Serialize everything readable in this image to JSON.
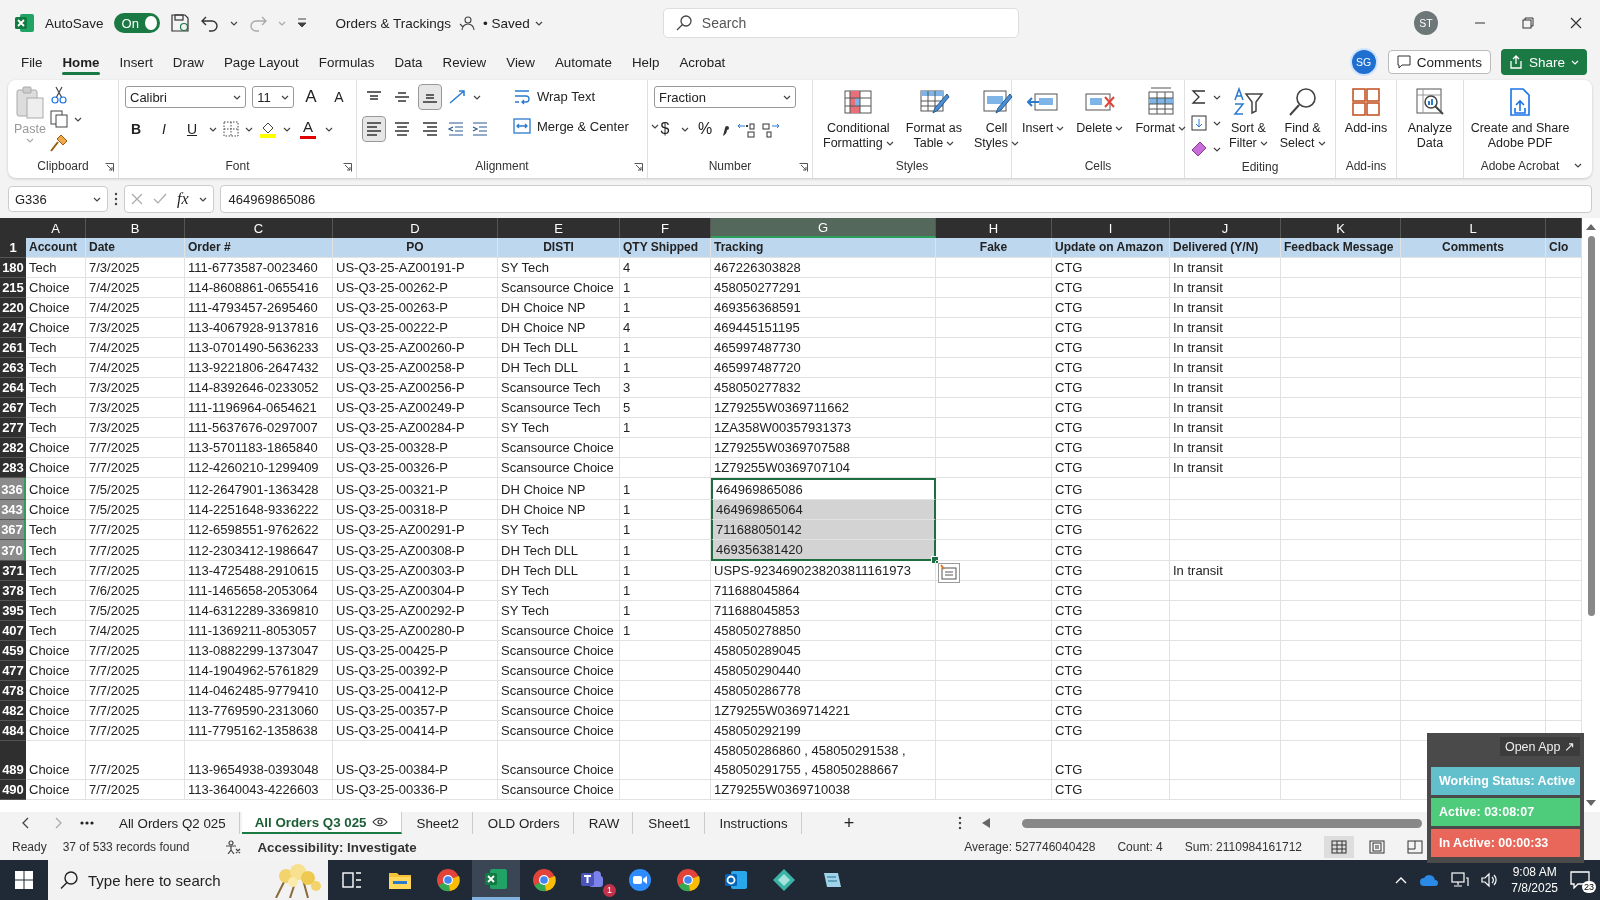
{
  "app": {
    "autosave_label": "AutoSave",
    "autosave_on": true,
    "autosave_state": "On",
    "title": "Orders & Trackings",
    "save_status": "• Saved",
    "search_placeholder": "Search",
    "user_initials": "ST"
  },
  "menu_tabs": [
    {
      "label": "File",
      "selected": false
    },
    {
      "label": "Home",
      "selected": true
    },
    {
      "label": "Insert",
      "selected": false
    },
    {
      "label": "Draw",
      "selected": false
    },
    {
      "label": "Page Layout",
      "selected": false
    },
    {
      "label": "Formulas",
      "selected": false
    },
    {
      "label": "Data",
      "selected": false
    },
    {
      "label": "Review",
      "selected": false
    },
    {
      "label": "View",
      "selected": false
    },
    {
      "label": "Automate",
      "selected": false
    },
    {
      "label": "Help",
      "selected": false
    },
    {
      "label": "Acrobat",
      "selected": false
    }
  ],
  "account": {
    "avatar": "SG",
    "comments": "Comments",
    "share": "Share"
  },
  "ribbon": {
    "clipboard": {
      "label": "Clipboard",
      "paste": "Paste",
      "paste_disabled": true
    },
    "font": {
      "label": "Font",
      "family": "Calibri",
      "size": "11",
      "size_buttons": [
        "A",
        "A"
      ],
      "style_buttons": [
        "B",
        "I",
        "U"
      ],
      "color_button": "A"
    },
    "alignment": {
      "label": "Alignment",
      "wrap": "Wrap Text",
      "merge": "Merge & Center",
      "vertical": [
        {
          "selected": false
        },
        {
          "selected": false
        },
        {
          "selected": true
        }
      ],
      "horizontal": [
        {
          "selected": true
        },
        {
          "selected": false
        },
        {
          "selected": false
        }
      ]
    },
    "number": {
      "label": "Number",
      "format": "Fraction",
      "symbols": [
        "$",
        "%"
      ]
    },
    "styles": {
      "label": "Styles",
      "buttons": [
        {
          "lines": [
            "Conditional",
            "Formatting"
          ],
          "dropdown": true
        },
        {
          "lines": [
            "Format as",
            "Table"
          ],
          "dropdown": true
        },
        {
          "lines": [
            "Cell",
            "Styles"
          ],
          "dropdown": true
        }
      ]
    },
    "cells": {
      "label": "Cells",
      "buttons": [
        {
          "lines": [
            "Insert"
          ],
          "dropdown": true
        },
        {
          "lines": [
            "Delete"
          ],
          "dropdown": true
        },
        {
          "lines": [
            "Format"
          ],
          "dropdown": true
        }
      ]
    },
    "editing": {
      "label": "Editing",
      "buttons": [
        {
          "lines": [
            "Sort &",
            "Filter"
          ],
          "dropdown": true
        },
        {
          "lines": [
            "Find &",
            "Select"
          ],
          "dropdown": true
        }
      ]
    },
    "addins": {
      "label": "Add-ins",
      "buttons": [
        {
          "lines": [
            "Add-ins"
          ],
          "dropdown": false
        }
      ]
    },
    "analysis": {
      "buttons": [
        {
          "lines": [
            "Analyze",
            "Data"
          ],
          "dropdown": false
        }
      ]
    },
    "acrobat": {
      "label": "Adobe Acrobat",
      "buttons": [
        {
          "lines": [
            "Create and Share",
            "Adobe PDF"
          ],
          "dropdown": false
        }
      ]
    }
  },
  "formula_bar": {
    "name_box": "G336",
    "function_label": "fx",
    "value": "464969865086"
  },
  "columns": [
    {
      "letter": "A",
      "header": "Account",
      "selected": false
    },
    {
      "letter": "B",
      "header": "Date",
      "selected": false
    },
    {
      "letter": "C",
      "header": "Order #",
      "selected": false
    },
    {
      "letter": "D",
      "header": "PO",
      "selected": false
    },
    {
      "letter": "E",
      "header": "DISTI",
      "selected": false
    },
    {
      "letter": "F",
      "header": "QTY Shipped",
      "selected": false
    },
    {
      "letter": "G",
      "header": "Tracking",
      "selected": true
    },
    {
      "letter": "H",
      "header": "Fake",
      "selected": false
    },
    {
      "letter": "I",
      "header": "Update on Amazon",
      "selected": false
    },
    {
      "letter": "J",
      "header": "Delivered (Y/N)",
      "selected": false
    },
    {
      "letter": "K",
      "header": "Feedback Message",
      "selected": false
    },
    {
      "letter": "L",
      "header": "Comments",
      "selected": false
    },
    {
      "header": "Clo",
      "selected": false
    }
  ],
  "header_row": "1",
  "rows": [
    {
      "n": "180",
      "selected": false,
      "account": "Tech",
      "date": "7/3/2025",
      "order": "111-6773587-0023460",
      "po": "US-Q3-25-AZ00191-P",
      "disti": "SY Tech",
      "qty": "4",
      "tracking": "467226303828",
      "update": "CTG",
      "delivered": "In transit"
    },
    {
      "n": "215",
      "selected": false,
      "account": "Choice",
      "date": "7/4/2025",
      "order": "114-8608861-0655416",
      "po": "US-Q3-25-00262-P",
      "disti": "Scansource Choice",
      "qty": "1",
      "tracking": "458050277291",
      "update": "CTG",
      "delivered": "In transit"
    },
    {
      "n": "220",
      "selected": false,
      "account": "Choice",
      "date": "7/4/2025",
      "order": "111-4793457-2695460",
      "po": "US-Q3-25-00263-P",
      "disti": "DH Choice NP",
      "qty": "1",
      "tracking": "469356368591",
      "update": "CTG",
      "delivered": "In transit"
    },
    {
      "n": "247",
      "selected": false,
      "account": "Choice",
      "date": "7/3/2025",
      "order": "113-4067928-9137816",
      "po": "US-Q3-25-00222-P",
      "disti": "DH Choice NP",
      "qty": "4",
      "tracking": "469445151195",
      "update": "CTG",
      "delivered": "In transit"
    },
    {
      "n": "261",
      "selected": false,
      "account": "Tech",
      "date": "7/4/2025",
      "order": "113-0701490-5636233",
      "po": "US-Q3-25-AZ00260-P",
      "disti": "DH Tech DLL",
      "qty": "1",
      "tracking": "465997487730",
      "update": "CTG",
      "delivered": "In transit"
    },
    {
      "n": "263",
      "selected": false,
      "account": "Tech",
      "date": "7/4/2025",
      "order": "113-9221806-2647432",
      "po": "US-Q3-25-AZ00258-P",
      "disti": "DH Tech DLL",
      "qty": "1",
      "tracking": "465997487720",
      "update": "CTG",
      "delivered": "In transit"
    },
    {
      "n": "264",
      "selected": false,
      "account": "Tech",
      "date": "7/3/2025",
      "order": "114-8392646-0233052",
      "po": "US-Q3-25-AZ00256-P",
      "disti": "Scansource Tech",
      "qty": "3",
      "tracking": "458050277832",
      "update": "CTG",
      "delivered": "In transit"
    },
    {
      "n": "267",
      "selected": false,
      "account": "Tech",
      "date": "7/3/2025",
      "order": "111-1196964-0654621",
      "po": "US-Q3-25-AZ00249-P",
      "disti": "Scansource Tech",
      "qty": "5",
      "tracking": "1Z79255W0369711662",
      "update": "CTG",
      "delivered": "In transit"
    },
    {
      "n": "277",
      "selected": false,
      "account": "Tech",
      "date": "7/3/2025",
      "order": "111-5637676-0297007",
      "po": "US-Q3-25-AZ00284-P",
      "disti": "SY Tech",
      "qty": "1",
      "tracking": "1ZA358W00357931373",
      "update": "CTG",
      "delivered": "In transit"
    },
    {
      "n": "282",
      "selected": false,
      "account": "Choice",
      "date": "7/7/2025",
      "order": "113-5701183-1865840",
      "po": "US-Q3-25-00328-P",
      "disti": "Scansource Choice",
      "tracking": "1Z79255W0369707588",
      "update": "CTG",
      "delivered": "In transit"
    },
    {
      "n": "283",
      "selected": false,
      "account": "Choice",
      "date": "7/7/2025",
      "order": "112-4260210-1299409",
      "po": "US-Q3-25-00326-P",
      "disti": "Scansource Choice",
      "tracking": "1Z79255W0369707104",
      "update": "CTG",
      "delivered": "In transit"
    },
    {
      "n": "336",
      "selected": true,
      "account": "Choice",
      "date": "7/5/2025",
      "order": "112-2647901-1363428",
      "po": "US-Q3-25-00321-P",
      "disti": "DH Choice NP",
      "qty": "1",
      "tracking": "464969865086",
      "update": "CTG"
    },
    {
      "n": "343",
      "selected": true,
      "account": "Choice",
      "date": "7/5/2025",
      "order": "114-2251648-9336222",
      "po": "US-Q3-25-00318-P",
      "disti": "DH Choice NP",
      "qty": "1",
      "tracking": "464969865064",
      "update": "CTG"
    },
    {
      "n": "367",
      "selected": true,
      "account": "Tech",
      "date": "7/7/2025",
      "order": "112-6598551-9762622",
      "po": "US-Q3-25-AZ00291-P",
      "disti": "SY Tech",
      "qty": "1",
      "tracking": "711688050142",
      "update": "CTG"
    },
    {
      "n": "370",
      "selected": true,
      "account": "Tech",
      "date": "7/7/2025",
      "order": "112-2303412-1986647",
      "po": "US-Q3-25-AZ00308-P",
      "disti": "DH Tech DLL",
      "qty": "1",
      "tracking": "469356381420",
      "update": "CTG"
    },
    {
      "n": "371",
      "selected": false,
      "account": "Tech",
      "date": "7/7/2025",
      "order": "113-4725488-2910615",
      "po": "US-Q3-25-AZ00303-P",
      "disti": "DH Tech DLL",
      "qty": "1",
      "tracking": "USPS-9234690238203811161973",
      "update": "CTG",
      "delivered": "In transit"
    },
    {
      "n": "378",
      "selected": false,
      "account": "Tech",
      "date": "7/6/2025",
      "order": "111-1465658-2053064",
      "po": "US-Q3-25-AZ00304-P",
      "disti": "SY Tech",
      "qty": "1",
      "tracking": "711688045864",
      "update": "CTG"
    },
    {
      "n": "395",
      "selected": false,
      "account": "Tech",
      "date": "7/5/2025",
      "order": "114-6312289-3369810",
      "po": "US-Q3-25-AZ00292-P",
      "disti": "SY Tech",
      "qty": "1",
      "tracking": "711688045853",
      "update": "CTG"
    },
    {
      "n": "407",
      "selected": false,
      "account": "Tech",
      "date": "7/4/2025",
      "order": "111-1369211-8053057",
      "po": "US-Q3-25-AZ00280-P",
      "disti": "Scansource Choice",
      "qty": "1",
      "tracking": "458050278850",
      "update": "CTG"
    },
    {
      "n": "459",
      "selected": false,
      "account": "Choice",
      "date": "7/7/2025",
      "order": "113-0882299-1373047",
      "po": "US-Q3-25-00425-P",
      "disti": "Scansource Choice",
      "tracking": "458050289045",
      "update": "CTG"
    },
    {
      "n": "477",
      "selected": false,
      "account": "Choice",
      "date": "7/7/2025",
      "order": "114-1904962-5761829",
      "po": "US-Q3-25-00392-P",
      "disti": "Scansource Choice",
      "tracking": "458050290440",
      "update": "CTG"
    },
    {
      "n": "478",
      "selected": false,
      "account": "Choice",
      "date": "7/7/2025",
      "order": "114-0462485-9779410",
      "po": "US-Q3-25-00412-P",
      "disti": "Scansource Choice",
      "tracking": "458050286778",
      "update": "CTG"
    },
    {
      "n": "482",
      "selected": false,
      "account": "Choice",
      "date": "7/7/2025",
      "order": "113-7769590-2313060",
      "po": "US-Q3-25-00357-P",
      "disti": "Scansource Choice",
      "tracking": "1Z79255W0369714221",
      "update": "CTG"
    },
    {
      "n": "484",
      "selected": false,
      "account": "Choice",
      "date": "7/7/2025",
      "order": "111-7795162-1358638",
      "po": "US-Q3-25-00414-P",
      "disti": "Scansource Choice",
      "tracking": "458050292199",
      "update": "CTG"
    },
    {
      "n": "489",
      "selected": false,
      "account": "Choice",
      "date": "7/7/2025",
      "order": "113-9654938-0393048",
      "po": "US-Q3-25-00384-P",
      "disti": "Scansource Choice",
      "tracking": "458050286860 , 458050291538 , 458050291755 , 458050288667",
      "update": "CTG"
    },
    {
      "n": "490",
      "selected": false,
      "account": "Choice",
      "date": "7/7/2025",
      "order": "113-3640043-4226603",
      "po": "US-Q3-25-00336-P",
      "disti": "Scansource Choice",
      "tracking": "1Z79255W0369710038",
      "update": "CTG"
    }
  ],
  "sheet_tabs": [
    {
      "label": "All Orders Q2 025",
      "selected": false
    },
    {
      "label": "All Orders Q3 025",
      "selected": true
    },
    {
      "label": "Sheet2",
      "selected": false
    },
    {
      "label": "OLD Orders",
      "selected": false
    },
    {
      "label": "RAW",
      "selected": false
    },
    {
      "label": "Sheet1",
      "selected": false
    },
    {
      "label": "Instructions",
      "selected": false
    }
  ],
  "add_sheet": "+",
  "status_bar": {
    "ready": "Ready",
    "records": "37 of 533 records found",
    "accessibility": "Accessibility: Investigate",
    "average": "Average: 527746040428",
    "count": "Count: 4",
    "sum": "Sum: 2110984161712",
    "views": [
      {
        "selected": true
      },
      {
        "selected": false
      },
      {
        "selected": false
      }
    ]
  },
  "tracker": {
    "open_label": "Open App ↗",
    "items": [
      {
        "label": "Working Status: Active",
        "color": "#62bfcc"
      },
      {
        "label": "Active: 03:08:07",
        "color": "#4fcb7c"
      },
      {
        "label": "In Active: 00:00:33",
        "color": "#e8675a"
      }
    ]
  },
  "taskbar": {
    "search_placeholder": "Type here to search",
    "apps": [
      {
        "kind": "taskview",
        "selected": false
      },
      {
        "kind": "folder",
        "selected": false
      },
      {
        "kind": "browser",
        "selected": false
      },
      {
        "kind": "spreadsheet",
        "selected": true
      },
      {
        "kind": "browser",
        "selected": false
      },
      {
        "kind": "chat",
        "selected": false,
        "badge": "1"
      },
      {
        "kind": "video",
        "selected": false
      },
      {
        "kind": "browser",
        "selected": false
      },
      {
        "kind": "mail",
        "selected": false
      },
      {
        "kind": "diamond",
        "selected": false
      },
      {
        "kind": "notes",
        "selected": false
      }
    ],
    "time": "9:08 AM",
    "date": "7/8/2025",
    "notifications": "23"
  }
}
